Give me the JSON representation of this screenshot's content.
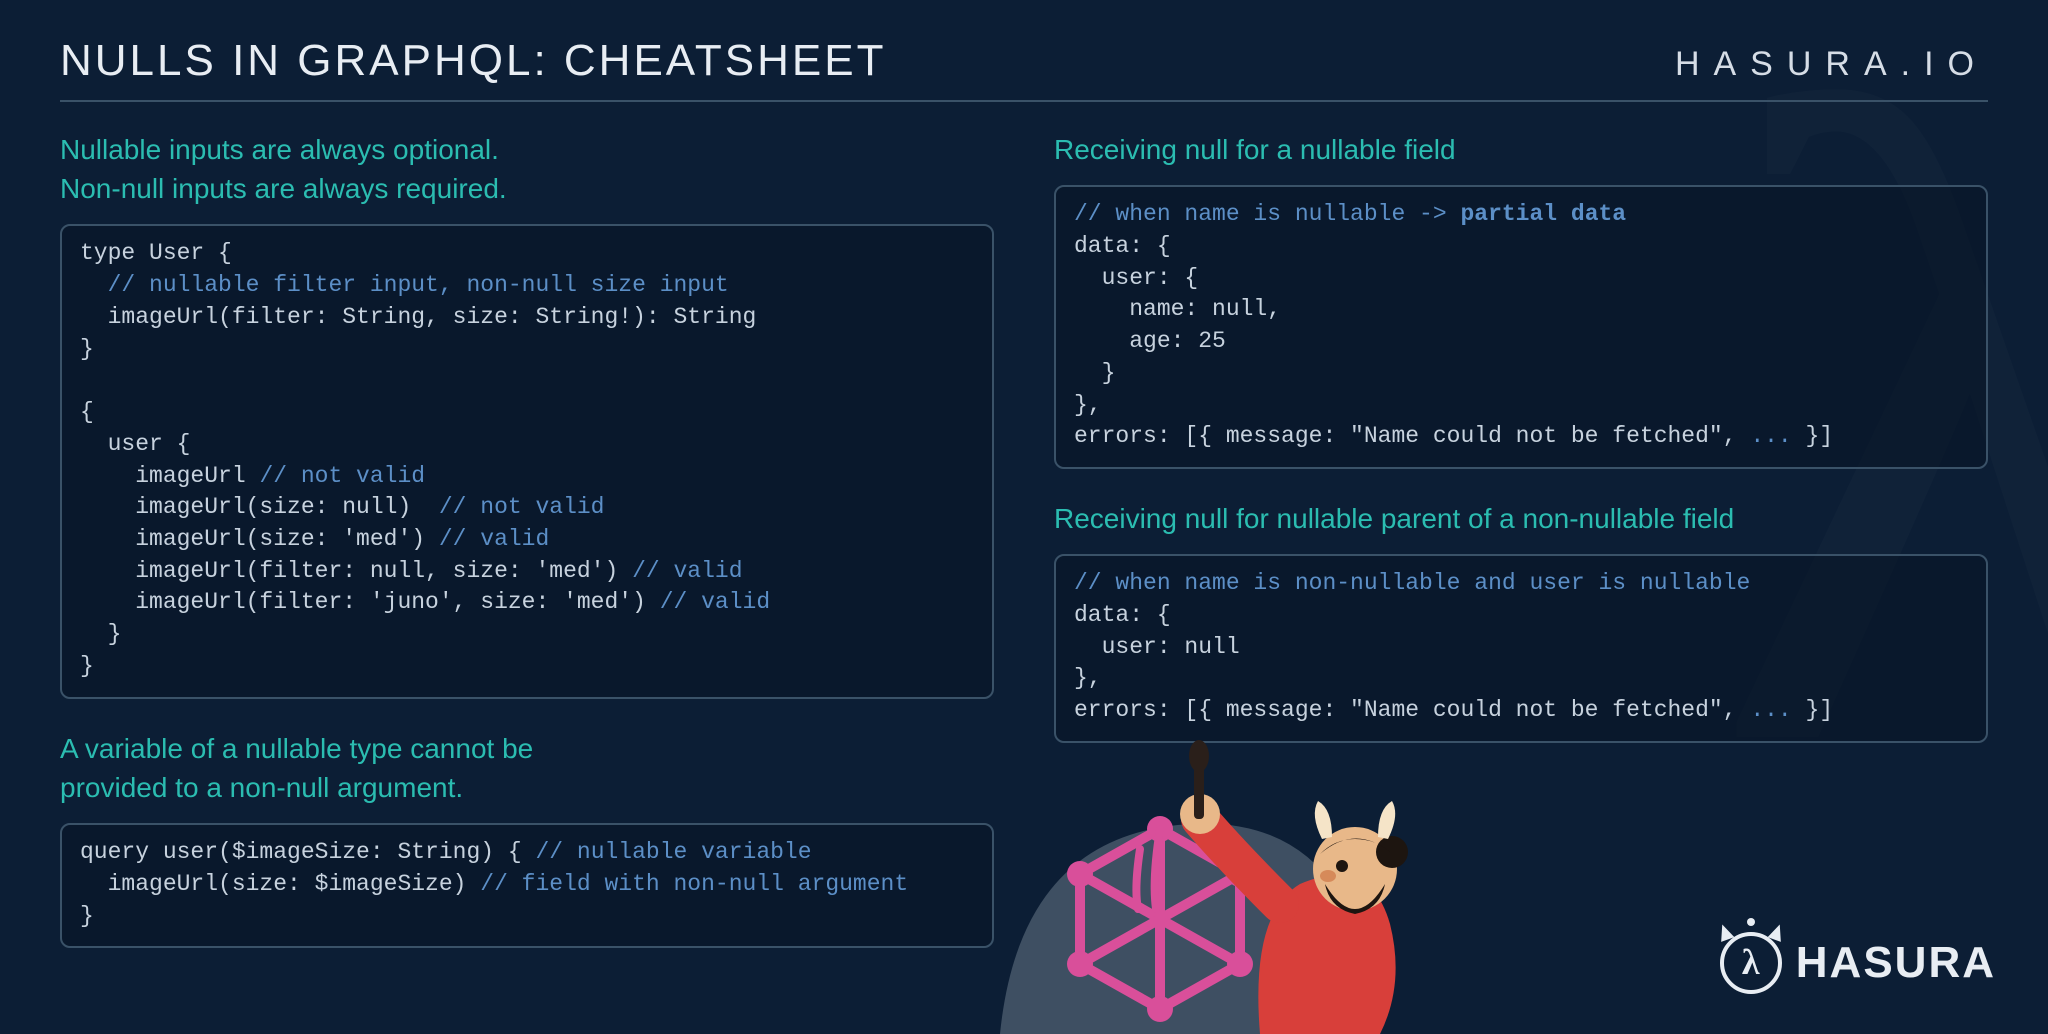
{
  "header": {
    "title": "NULLS IN GRAPHQL: CHEATSHEET",
    "brand_url": "HASURA.IO"
  },
  "left": {
    "heading1_line1": "Nullable inputs are always optional.",
    "heading1_line2": "Non-null inputs are always required.",
    "code1": {
      "l01": "type User {",
      "l02_comment": "  // nullable filter input, non-null size input",
      "l03": "  imageUrl(filter: String, size: String!): String",
      "l04": "}",
      "l05": "",
      "l06": "{",
      "l07": "  user {",
      "l08a": "    imageUrl ",
      "l08c": "// not valid",
      "l09a": "    imageUrl(size: null)  ",
      "l09c": "// not valid",
      "l10a": "    imageUrl(size: 'med') ",
      "l10c": "// valid",
      "l11a": "    imageUrl(filter: null, size: 'med') ",
      "l11c": "// valid",
      "l12a": "    imageUrl(filter: 'juno', size: 'med') ",
      "l12c": "// valid",
      "l13": "  }",
      "l14": "}"
    },
    "heading2_line1": "A variable of a nullable type cannot be",
    "heading2_line2": "provided to a non-null argument.",
    "code2": {
      "l01a": "query user($imageSize: String) { ",
      "l01c": "// nullable variable",
      "l02a": "  imageUrl(size: $imageSize) ",
      "l02c": "// field with non-null argument",
      "l03": "}"
    }
  },
  "right": {
    "heading1": "Receiving null for a nullable field",
    "code1": {
      "l01a": "// when name is nullable -> ",
      "l01b": "partial data",
      "l02": "data: {",
      "l03": "  user: {",
      "l04": "    name: null,",
      "l05": "    age: 25",
      "l06": "  }",
      "l07": "},",
      "l08a": "errors: [{ message: \"Name could not be fetched\", ",
      "l08b": "...",
      "l08c": " }]"
    },
    "heading2": "Receiving null for nullable parent of a non-nullable field",
    "code2": {
      "l01": "// when name is non-nullable and user is nullable",
      "l02": "data: {",
      "l03": "  user: null",
      "l04": "},",
      "l05a": "errors: [{ message: \"Name could not be fetched\", ",
      "l05b": "...",
      "l05c": " }]"
    }
  },
  "logo": {
    "word": "HASURA"
  }
}
